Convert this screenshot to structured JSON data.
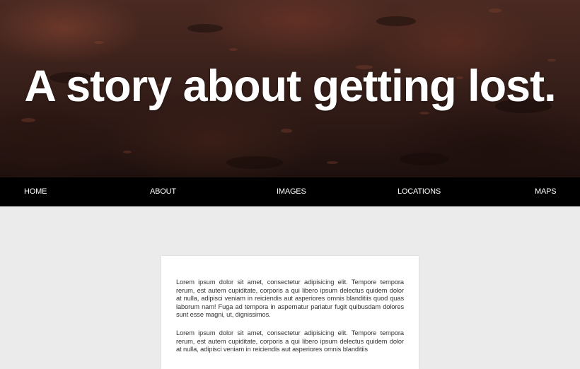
{
  "hero": {
    "title": "A story about getting lost."
  },
  "nav": {
    "items": [
      {
        "label": "HOME"
      },
      {
        "label": "ABOUT"
      },
      {
        "label": "IMAGES"
      },
      {
        "label": "LOCATIONS"
      },
      {
        "label": "MAPS"
      }
    ]
  },
  "article": {
    "paragraphs": [
      "Lorem ipsum dolor sit amet, consectetur adipisicing elit. Tempore tempora rerum, est autem cupiditate, corporis a qui libero ipsum delectus quidem dolor at nulla, adipisci veniam in reiciendis aut asperiores omnis blanditiis quod quas laborum nam! Fuga ad tempora in aspernatur pariatur fugit quibusdam dolores sunt esse magni, ut, dignissimos.",
      "Lorem ipsum dolor sit amet, consectetur adipisicing elit. Tempore tempora rerum, est autem cupiditate, corporis a qui libero ipsum delectus quidem dolor at nulla, adipisci veniam in reiciendis aut asperiores omnis blanditiis"
    ]
  },
  "colors": {
    "nav_background": "#000000",
    "page_background": "#ebebeb",
    "card_background": "#ffffff",
    "hero_text": "#ffffff"
  }
}
